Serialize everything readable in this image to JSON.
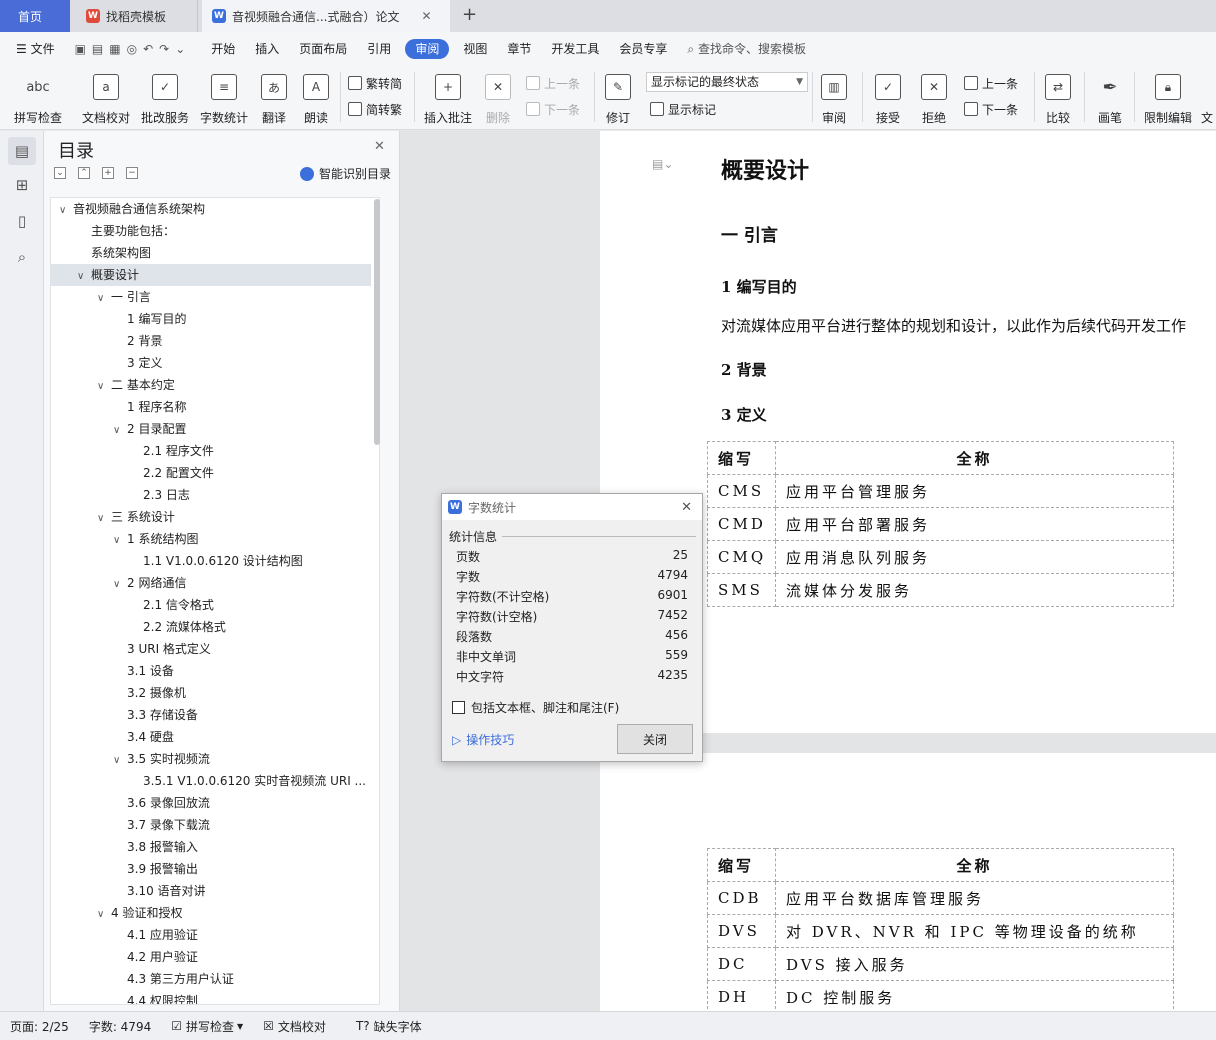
{
  "tabs": {
    "home": "首页",
    "template": "找稻壳模板",
    "doc": "音视频融合通信...式融合）论文",
    "add": "+"
  },
  "menu": {
    "file": "文件",
    "items": [
      "开始",
      "插入",
      "页面布局",
      "引用",
      "审阅",
      "视图",
      "章节",
      "开发工具",
      "会员专享"
    ],
    "search": "查找命令、搜索模板"
  },
  "ribbon": {
    "spell": "拼写检查",
    "proof": "文档校对",
    "batch": "批改服务",
    "wordcount": "字数统计",
    "translate": "翻译",
    "read": "朗读",
    "trad": "繁转简",
    "simp": "简转繁",
    "insert_comment": "插入批注",
    "delete": "删除",
    "prev": "上一条",
    "next": "下一条",
    "revise": "修订",
    "markup_state": "显示标记的最终状态",
    "show_markup": "显示标记",
    "review": "审阅",
    "accept": "接受",
    "reject": "拒绝",
    "prev2": "上一条",
    "next2": "下一条",
    "compare": "比较",
    "pen": "画笔",
    "restrict": "限制编辑",
    "doc_right": "文"
  },
  "toc": {
    "title": "目录",
    "smart": "智能识别目录",
    "items": [
      {
        "t": "音视频融合通信系统架构",
        "lv": 0,
        "c": "v"
      },
      {
        "t": "主要功能包括：",
        "lv": 1,
        "c": ""
      },
      {
        "t": "系统架构图",
        "lv": 1,
        "c": ""
      },
      {
        "t": "概要设计",
        "lv": 1,
        "c": "v",
        "sel": true
      },
      {
        "t": "一 引言",
        "lv": 2,
        "c": "v"
      },
      {
        "t": "1 编写目的",
        "lv": 3,
        "c": ""
      },
      {
        "t": "2 背景",
        "lv": 3,
        "c": ""
      },
      {
        "t": "3 定义",
        "lv": 3,
        "c": ""
      },
      {
        "t": "二 基本约定",
        "lv": 2,
        "c": "v"
      },
      {
        "t": "1 程序名称",
        "lv": 3,
        "c": ""
      },
      {
        "t": "2 目录配置",
        "lv": 3,
        "c": "v"
      },
      {
        "t": "2.1 程序文件",
        "lv": 4,
        "c": ""
      },
      {
        "t": "2.2 配置文件",
        "lv": 4,
        "c": ""
      },
      {
        "t": "2.3 日志",
        "lv": 4,
        "c": ""
      },
      {
        "t": "三 系统设计",
        "lv": 2,
        "c": "v"
      },
      {
        "t": "1 系统结构图",
        "lv": 3,
        "c": "v"
      },
      {
        "t": "1.1 V1.0.0.6120 设计结构图",
        "lv": 4,
        "c": ""
      },
      {
        "t": "2 网络通信",
        "lv": 3,
        "c": "v"
      },
      {
        "t": "2.1 信令格式",
        "lv": 4,
        "c": ""
      },
      {
        "t": "2.2 流媒体格式",
        "lv": 4,
        "c": ""
      },
      {
        "t": "3 URI 格式定义",
        "lv": 3,
        "c": ""
      },
      {
        "t": "3.1 设备",
        "lv": 3,
        "c": ""
      },
      {
        "t": "3.2 摄像机",
        "lv": 3,
        "c": ""
      },
      {
        "t": "3.3 存储设备",
        "lv": 3,
        "c": ""
      },
      {
        "t": "3.4 硬盘",
        "lv": 3,
        "c": ""
      },
      {
        "t": "3.5 实时视频流",
        "lv": 3,
        "c": "v"
      },
      {
        "t": "3.5.1 V1.0.0.6120 实时音视频流 URI ...",
        "lv": 4,
        "c": ""
      },
      {
        "t": "3.6 录像回放流",
        "lv": 3,
        "c": ""
      },
      {
        "t": "3.7 录像下载流",
        "lv": 3,
        "c": ""
      },
      {
        "t": "3.8 报警输入",
        "lv": 3,
        "c": ""
      },
      {
        "t": "3.9 报警输出",
        "lv": 3,
        "c": ""
      },
      {
        "t": "3.10 语音对讲",
        "lv": 3,
        "c": ""
      },
      {
        "t": "4 验证和授权",
        "lv": 2,
        "c": "v"
      },
      {
        "t": "4.1 应用验证",
        "lv": 3,
        "c": ""
      },
      {
        "t": "4.2 用户验证",
        "lv": 3,
        "c": ""
      },
      {
        "t": "4.3 第三方用户认证",
        "lv": 3,
        "c": ""
      },
      {
        "t": "4.4 权限控制",
        "lv": 3,
        "c": ""
      }
    ]
  },
  "doc": {
    "h1": "概要设计",
    "h2": "一 引言",
    "h3a": "1 编写目的",
    "p1": "对流媒体应用平台进行整体的规划和设计，以此作为后续代码开发工作",
    "h3b": "2 背景",
    "h3c": "3 定义",
    "table1": [
      [
        "缩写",
        "全称"
      ],
      [
        "CMS",
        "应用平台管理服务"
      ],
      [
        "CMD",
        "应用平台部署服务"
      ],
      [
        "CMQ",
        "应用消息队列服务"
      ],
      [
        "SMS",
        "流媒体分发服务"
      ]
    ],
    "table2": [
      [
        "缩写",
        "全称"
      ],
      [
        "CDB",
        "应用平台数据库管理服务"
      ],
      [
        "DVS",
        "对 DVR、NVR 和 IPC 等物理设备的统称"
      ],
      [
        "DC",
        "DVS 接入服务"
      ],
      [
        "DH",
        "DC 控制服务"
      ]
    ]
  },
  "dialog": {
    "title": "字数统计",
    "section": "统计信息",
    "rows": [
      [
        "页数",
        "25"
      ],
      [
        "字数",
        "4794"
      ],
      [
        "字符数(不计空格)",
        "6901"
      ],
      [
        "字符数(计空格)",
        "7452"
      ],
      [
        "段落数",
        "456"
      ],
      [
        "非中文单词",
        "559"
      ],
      [
        "中文字符",
        "4235"
      ]
    ],
    "checkbox": "包括文本框、脚注和尾注(F)",
    "tips": "操作技巧",
    "close": "关闭"
  },
  "status": {
    "page": "页面: 2/25",
    "words": "字数: 4794",
    "spell": "拼写检查",
    "proof": "文档校对",
    "font": "缺失字体"
  }
}
